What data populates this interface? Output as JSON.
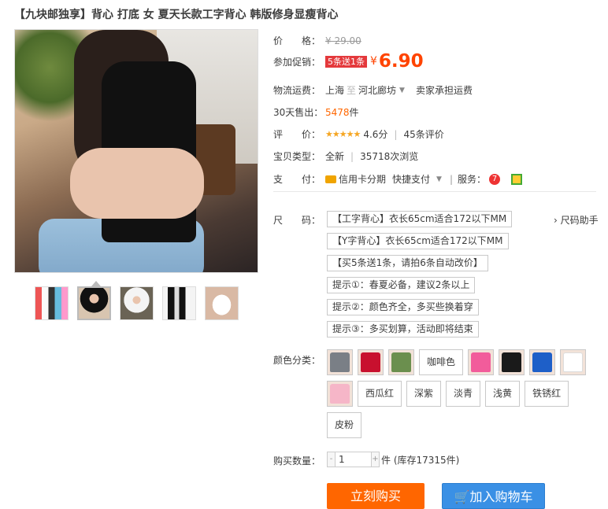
{
  "title": "【九块邮独享】背心 打底 女 夏天长款工字背心 韩版修身显瘦背心",
  "price": {
    "label": "价　　格：",
    "original": "¥ 29.00"
  },
  "promotion": {
    "label": "参加促销：",
    "tag": "5条送1条",
    "currency": "¥",
    "price": "6.90"
  },
  "shipping": {
    "label": "物流运费：",
    "from": "上海",
    "sep": "至",
    "to": "河北廊坊",
    "fee": "卖家承担运费"
  },
  "sales": {
    "label": "30天售出：",
    "count": "5478",
    "unit": "件"
  },
  "rating": {
    "label": "评　　价：",
    "stars": "★★★★★",
    "score": "4.6分",
    "reviews": "45条评价"
  },
  "item_type": {
    "label": "宝贝类型：",
    "type": "全新",
    "views": "35718次浏览"
  },
  "payment": {
    "label": "支　　付：",
    "credit": "信用卡分期",
    "quick": "快捷支付",
    "service_label": "服务："
  },
  "size": {
    "label": "尺　　码：",
    "help": "› 尺码助手",
    "options": [
      "【工字背心】衣长65cm适合172以下MM",
      "【Y字背心】衣长65cm适合172以下MM",
      "【买5条送1条，请拍6条自动改价】",
      "提示①：春夏必备，建议2条以上",
      "提示②：颜色齐全，多买些换着穿",
      "提示③：多买划算，活动即将结束"
    ]
  },
  "color": {
    "label": "颜色分类：",
    "text_options": [
      "咖啡色",
      "西瓜红",
      "深紫",
      "淡青",
      "浅黄",
      "铁锈红",
      "皮粉"
    ],
    "swatches": [
      "#7a7f86",
      "#c8102e",
      "#6b8f4e",
      "#f25c9b",
      "#1a1a1a",
      "#1e5fc8",
      "#ffffff",
      "#f6b6c8"
    ]
  },
  "quantity": {
    "label": "购买数量：",
    "minus": "-",
    "value": "1",
    "plus": "+",
    "stock": "件 (库存17315件)"
  },
  "buttons": {
    "buy": "立刻购买",
    "cart": "加入购物车",
    "cart_icon": "cart-icon"
  }
}
